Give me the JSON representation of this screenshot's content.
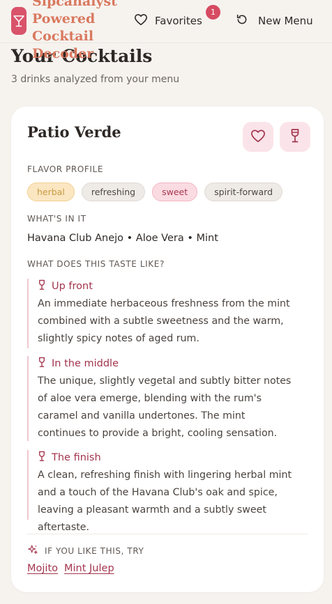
{
  "header": {
    "brand": "Sipcanalyst Powered Cocktail Decoder",
    "favorites_label": "Favorites",
    "favorites_count": "1",
    "new_menu_label": "New Menu"
  },
  "page": {
    "title": "Your Cocktails",
    "subtitle": "3 drinks analyzed from your menu"
  },
  "drink": {
    "name": "Patio Verde",
    "flavor_label": "FLAVOR PROFILE",
    "tags": [
      "herbal",
      "refreshing",
      "sweet",
      "spirit-forward"
    ],
    "ingredients_label": "WHAT'S IN IT",
    "ingredients": "Havana Club Anejo • Aloe Vera • Mint",
    "taste_label": "WHAT DOES THIS TASTE LIKE?",
    "taste": [
      {
        "title": "Up front",
        "text": "An immediate herbaceous freshness from the mint combined with a subtle sweetness and the warm, slightly spicy notes of aged rum."
      },
      {
        "title": "In the middle",
        "text": "The unique, slightly vegetal and subtly bitter notes of aloe vera emerge, blending with the rum's caramel and vanilla undertones. The mint continues to provide a bright, cooling sensation."
      },
      {
        "title": "The finish",
        "text": "A clean, refreshing finish with lingering herbal mint and a touch of the Havana Club's oak and spice, leaving a pleasant warmth and a subtly sweet aftertaste."
      }
    ],
    "try_label": "IF YOU LIKE THIS, TRY",
    "try": [
      "Mojito",
      "Mint Julep"
    ]
  },
  "colors": {
    "accent": "#d9536a",
    "accent_dark": "#a3354d",
    "background": "#f6f3ef",
    "card": "#ffffff"
  },
  "icons": [
    "cocktail-glass-icon",
    "heart-icon",
    "refresh-icon",
    "wine-glass-icon",
    "sparkles-icon"
  ]
}
